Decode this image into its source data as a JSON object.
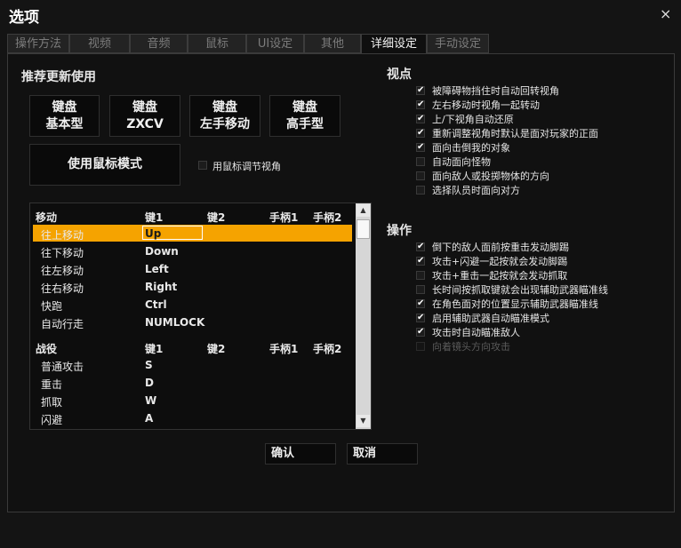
{
  "window": {
    "title": "选项"
  },
  "tabs": [
    {
      "label": "操作方法"
    },
    {
      "label": "视频"
    },
    {
      "label": "音频"
    },
    {
      "label": "鼠标"
    },
    {
      "label": "UI设定"
    },
    {
      "label": "其他"
    },
    {
      "label": "详细设定"
    },
    {
      "label": "手动设定"
    }
  ],
  "recommend": {
    "title": "推荐更新使用",
    "presets": [
      {
        "line1": "键盘",
        "line2": "基本型"
      },
      {
        "line1": "键盘",
        "line2": "ZXCV"
      },
      {
        "line1": "键盘",
        "line2": "左手移动"
      },
      {
        "line1": "键盘",
        "line2": "高手型"
      }
    ],
    "mouse_mode_label": "使用鼠标模式",
    "mouse_camera_label": "用鼠标调节视角"
  },
  "keytable": {
    "columns": [
      "键1",
      "键2",
      "手柄1",
      "手柄2"
    ],
    "sections": [
      {
        "name": "移动",
        "rows": [
          {
            "action": "往上移动",
            "key1": "Up"
          },
          {
            "action": "往下移动",
            "key1": "Down"
          },
          {
            "action": "往左移动",
            "key1": "Left"
          },
          {
            "action": "往右移动",
            "key1": "Right"
          },
          {
            "action": "快跑",
            "key1": "Ctrl"
          },
          {
            "action": "自动行走",
            "key1": "NUMLOCK"
          }
        ]
      },
      {
        "name": "战役",
        "rows": [
          {
            "action": "普通攻击",
            "key1": "S"
          },
          {
            "action": "重击",
            "key1": "D"
          },
          {
            "action": "抓取",
            "key1": "W"
          },
          {
            "action": "闪避",
            "key1": "A"
          }
        ]
      }
    ]
  },
  "viewpoint": {
    "title": "视点",
    "options": [
      {
        "label": "被障碍物挡住时自动回转视角",
        "checked": true
      },
      {
        "label": "左右移动时视角一起转动",
        "checked": true
      },
      {
        "label": "上/下视角自动还原",
        "checked": true
      },
      {
        "label": "重新调整视角时默认是面对玩家的正面",
        "checked": true
      },
      {
        "label": "面向击倒我的对象",
        "checked": true
      },
      {
        "label": "自动面向怪物",
        "checked": false
      },
      {
        "label": "面向敌人或投掷物体的方向",
        "checked": false
      },
      {
        "label": "选择队员时面向对方",
        "checked": false
      }
    ]
  },
  "operation": {
    "title": "操作",
    "options": [
      {
        "label": "倒下的敌人面前按重击发动脚踢",
        "checked": true
      },
      {
        "label": "攻击+闪避一起按就会发动脚踢",
        "checked": true
      },
      {
        "label": "攻击+重击一起按就会发动抓取",
        "checked": false
      },
      {
        "label": "长时间按抓取键就会出现辅助武器瞄准线",
        "checked": false
      },
      {
        "label": "在角色面对的位置显示辅助武器瞄准线",
        "checked": true
      },
      {
        "label": "启用辅助武器自动瞄准模式",
        "checked": true
      },
      {
        "label": "攻击时自动瞄准敌人",
        "checked": true
      },
      {
        "label": "向着镜头方向攻击",
        "checked": false,
        "disabled": true
      }
    ]
  },
  "buttons": {
    "confirm": "确认",
    "cancel": "取消"
  },
  "icons": {
    "close": "×",
    "check": "✔",
    "scroll_up": "▲",
    "scroll_down": "▼"
  },
  "colors": {
    "selected_row": "#f5a300"
  }
}
